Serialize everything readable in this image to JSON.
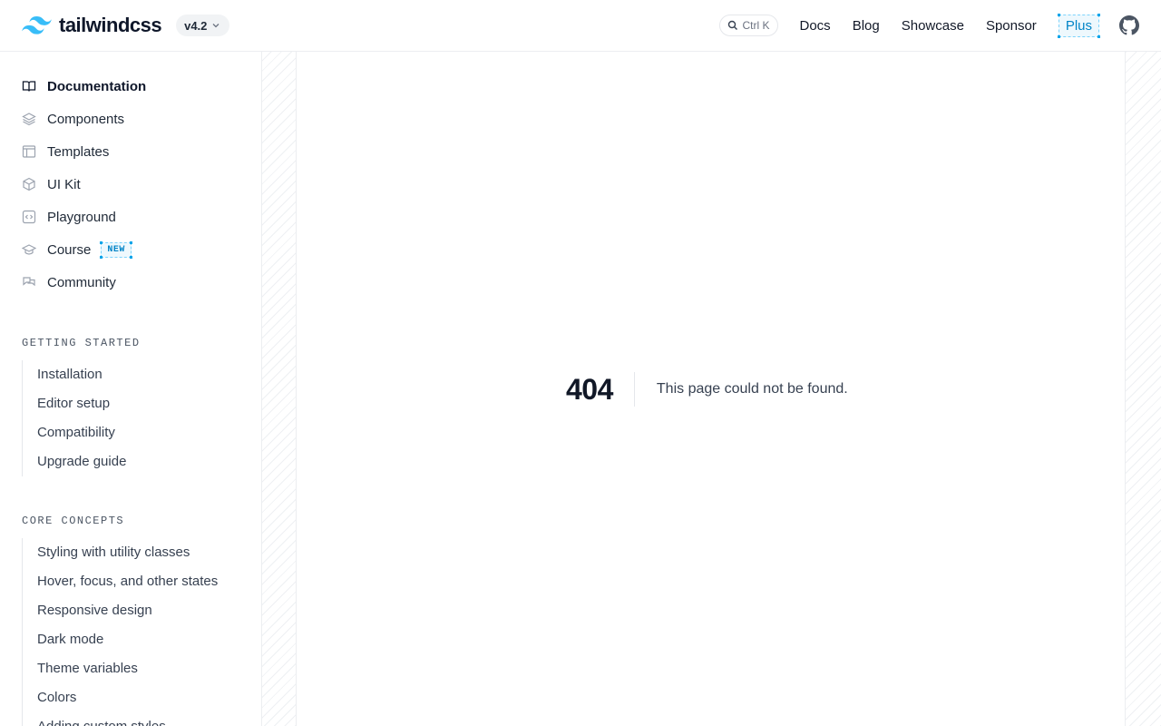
{
  "header": {
    "logo_text": "tailwindcss",
    "version": "v4.2",
    "search_shortcut": "Ctrl K",
    "nav": [
      "Docs",
      "Blog",
      "Showcase",
      "Sponsor"
    ],
    "plus_label": "Plus",
    "accent_color": "#0ea5e9"
  },
  "sidebar": {
    "top_items": [
      {
        "label": "Documentation",
        "icon": "book-icon",
        "active": true
      },
      {
        "label": "Components",
        "icon": "layers-icon"
      },
      {
        "label": "Templates",
        "icon": "layout-icon"
      },
      {
        "label": "UI Kit",
        "icon": "cube-icon"
      },
      {
        "label": "Playground",
        "icon": "code-icon"
      },
      {
        "label": "Course",
        "icon": "graduation-cap-icon",
        "badge": "NEW"
      },
      {
        "label": "Community",
        "icon": "chat-icon"
      }
    ],
    "sections": [
      {
        "title": "GETTING STARTED",
        "items": [
          "Installation",
          "Editor setup",
          "Compatibility",
          "Upgrade guide"
        ]
      },
      {
        "title": "CORE CONCEPTS",
        "items": [
          "Styling with utility classes",
          "Hover, focus, and other states",
          "Responsive design",
          "Dark mode",
          "Theme variables",
          "Colors",
          "Adding custom styles"
        ]
      }
    ]
  },
  "main": {
    "code": "404",
    "message": "This page could not be found."
  }
}
